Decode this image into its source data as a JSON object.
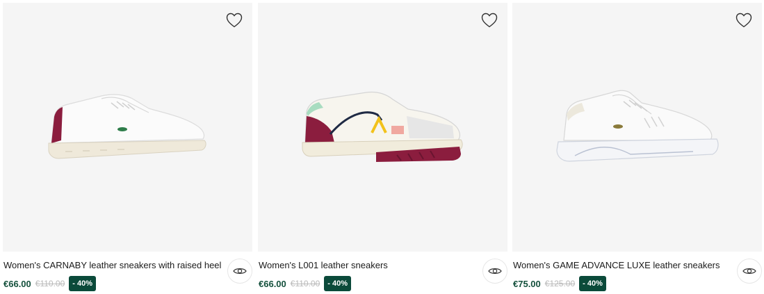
{
  "products": [
    {
      "name": "Women's CARNABY leather sneakers with raised heel",
      "price": "€66.00",
      "old_price": "€110.00",
      "discount": "- 40%",
      "image_icon": "white-sneaker-red-heel-tab",
      "wishlist_icon": "heart-outline-icon",
      "quickview_icon": "eye-icon"
    },
    {
      "name": "Women's L001 leather sneakers",
      "price": "€66.00",
      "old_price": "€110.00",
      "discount": "- 40%",
      "image_icon": "white-sneaker-colorblock",
      "wishlist_icon": "heart-outline-icon",
      "quickview_icon": "eye-icon"
    },
    {
      "name": "Women's GAME ADVANCE LUXE leather sneakers",
      "price": "€75.00",
      "old_price": "€125.00",
      "discount": "- 40%",
      "image_icon": "white-chunky-sneaker",
      "wishlist_icon": "heart-outline-icon",
      "quickview_icon": "eye-icon"
    }
  ],
  "colors": {
    "price": "#14503c",
    "badge_bg": "#0b4a3a",
    "image_bg": "#f5f5f5"
  }
}
